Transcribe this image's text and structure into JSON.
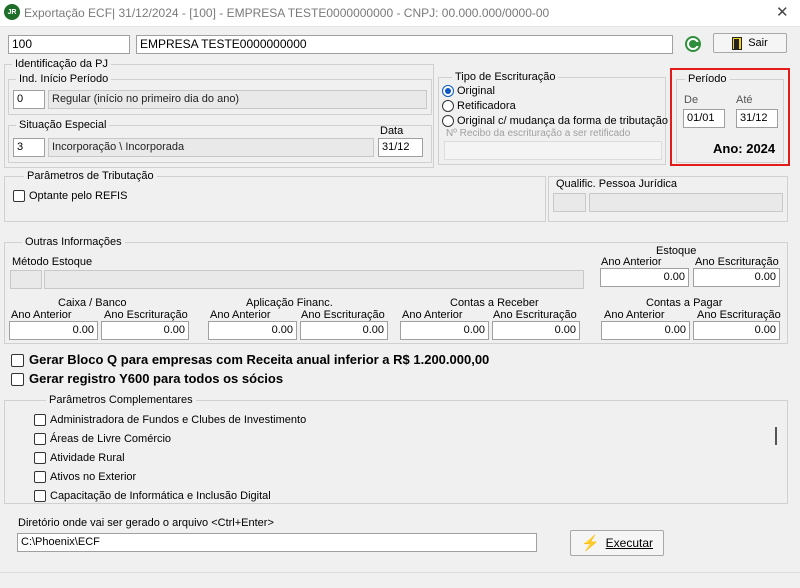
{
  "window": {
    "icon_text": "JR",
    "title": "Exportação ECF| 31/12/2024 - [100] - EMPRESA TESTE0000000000 - CNPJ: 00.000.000/0000-00",
    "close_glyph": "✕"
  },
  "header": {
    "code": "100",
    "company": "EMPRESA TESTE0000000000",
    "exit_label": "Sair"
  },
  "identificacao": {
    "legend": "Identificação da PJ",
    "inicio_periodo": {
      "legend": "Ind. Início Período",
      "code": "0",
      "description": "Regular (início no primeiro dia do ano)"
    },
    "situacao_especial": {
      "legend": "Situação Especial",
      "code": "3",
      "description": "Incorporação \\ Incorporada",
      "data_label": "Data",
      "data_value": "31/12"
    }
  },
  "tipo_escrituracao": {
    "legend": "Tipo de Escrituração",
    "options": [
      "Original",
      "Retificadora",
      "Original c/ mudança da forma de tributação"
    ],
    "selected": "Original",
    "recibo_placeholder": "Nº Recibo da escrituração a ser retificado"
  },
  "periodo": {
    "legend": "Período",
    "de_label": "De",
    "de_value": "01/01",
    "ate_label": "Até",
    "ate_value": "31/12",
    "ano_text": "Ano: 2024",
    "highlight_color": "#e21b1b"
  },
  "tributacao": {
    "legend": "Parâmetros de Tributação",
    "refis_label": "Optante pelo REFIS",
    "qualific_label": "Qualific. Pessoa Jurídica"
  },
  "outras": {
    "legend": "Outras Informações",
    "metodo_label": "Método Estoque",
    "estoque": {
      "title": "Estoque",
      "ano_anterior_label": "Ano Anterior",
      "ano_escrituracao_label": "Ano Escrituração",
      "ano_anterior": "0.00",
      "ano_escrituracao": "0.00"
    },
    "caixa": {
      "title": "Caixa / Banco",
      "ano_anterior_label": "Ano  Anterior",
      "ano_escrituracao_label": "Ano Escrituração",
      "ano_anterior": "0.00",
      "ano_escrituracao": "0.00"
    },
    "aplicacao": {
      "title": "Aplicação Financ.",
      "ano_anterior_label": "Ano  Anterior",
      "ano_escrituracao_label": "Ano Escrituração",
      "ano_anterior": "0.00",
      "ano_escrituracao": "0.00"
    },
    "receber": {
      "title": "Contas a Receber",
      "ano_anterior_label": "Ano Anterior",
      "ano_escrituracao_label": "Ano Escrituração",
      "ano_anterior": "0.00",
      "ano_escrituracao": "0.00"
    },
    "pagar": {
      "title": "Contas a Pagar",
      "ano_anterior_label": "Ano Anterior",
      "ano_escrituracao_label": "Ano Escrituração",
      "ano_anterior": "0.00",
      "ano_escrituracao": "0.00"
    }
  },
  "bloco_q_label": "Gerar Bloco Q para empresas com Receita anual inferior a R$ 1.200.000,00",
  "y600_label": "Gerar registro Y600 para todos os sócios",
  "complementares": {
    "legend": "Parâmetros Complementares",
    "items": [
      "Administradora de Fundos e Clubes de Investimento",
      "Áreas de Livre Comércio",
      "Atividade Rural",
      "Ativos no Exterior",
      "Capacitação de Informática e Inclusão Digital"
    ]
  },
  "diretorio": {
    "label": "Diretório onde vai ser gerado o arquivo <Ctrl+Enter>",
    "value": "C:\\Phoenix\\ECF",
    "executar_label": "Executar"
  }
}
